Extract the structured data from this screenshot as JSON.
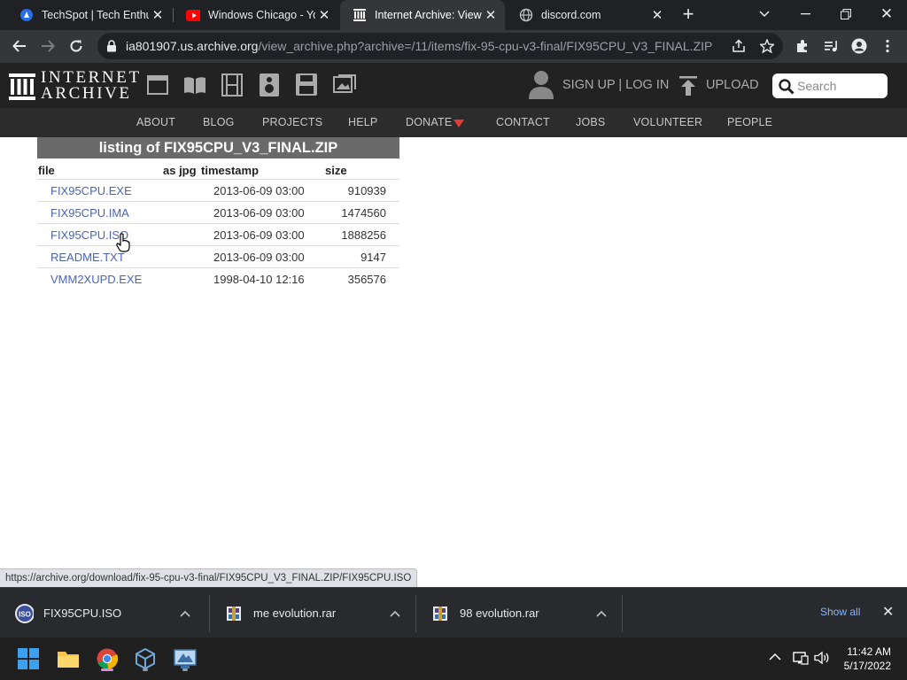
{
  "browser": {
    "tabs": [
      {
        "title": "TechSpot | Tech Enthusi",
        "favicon": "techspot-icon",
        "active": false
      },
      {
        "title": "Windows Chicago - You",
        "favicon": "youtube-icon",
        "active": false
      },
      {
        "title": "Internet Archive: View A",
        "favicon": "archive-icon",
        "active": true
      },
      {
        "title": "discord.com",
        "favicon": "globe-icon",
        "active": false
      }
    ],
    "url_host": "ia801907.us.archive.org",
    "url_path": "/view_archive.php?archive=/11/items/fix-95-cpu-v3-final/FIX95CPU_V3_FINAL.ZIP"
  },
  "ia_header": {
    "logo_line1": "INTERNET",
    "logo_line2": "ARCHIVE",
    "signup_login": "SIGN UP | LOG IN",
    "upload": "UPLOAD",
    "search_placeholder": "Search",
    "nav": [
      "ABOUT",
      "BLOG",
      "PROJECTS",
      "HELP",
      "DONATE",
      "CONTACT",
      "JOBS",
      "VOLUNTEER",
      "PEOPLE"
    ]
  },
  "listing": {
    "title": "listing of FIX95CPU_V3_FINAL.ZIP",
    "headers": {
      "file": "file",
      "as_jpg": "as jpg",
      "timestamp": "timestamp",
      "size": "size"
    },
    "rows": [
      {
        "file": "FIX95CPU.EXE",
        "timestamp": "2013-06-09 03:00",
        "size": "910939"
      },
      {
        "file": "FIX95CPU.IMA",
        "timestamp": "2013-06-09 03:00",
        "size": "1474560"
      },
      {
        "file": "FIX95CPU.ISO",
        "timestamp": "2013-06-09 03:00",
        "size": "1888256"
      },
      {
        "file": "README.TXT",
        "timestamp": "2013-06-09 03:00",
        "size": "9147"
      },
      {
        "file": "VMM2XUPD.EXE",
        "timestamp": "1998-04-10 12:16",
        "size": "356576"
      }
    ]
  },
  "status_url": "https://archive.org/download/fix-95-cpu-v3-final/FIX95CPU_V3_FINAL.ZIP/FIX95CPU.ISO",
  "downloads": {
    "items": [
      {
        "name": "FIX95CPU.ISO",
        "icon": "iso-file-icon"
      },
      {
        "name": "me evolution.rar",
        "icon": "rar-file-icon"
      },
      {
        "name": "98 evolution.rar",
        "icon": "rar-file-icon"
      }
    ],
    "show_all": "Show all"
  },
  "taskbar": {
    "time": "11:42 AM",
    "date": "5/17/2022"
  },
  "colors": {
    "link": "#4b65b0",
    "donate_heart": "#e53935",
    "accent_blue": "#8ab4f8"
  }
}
